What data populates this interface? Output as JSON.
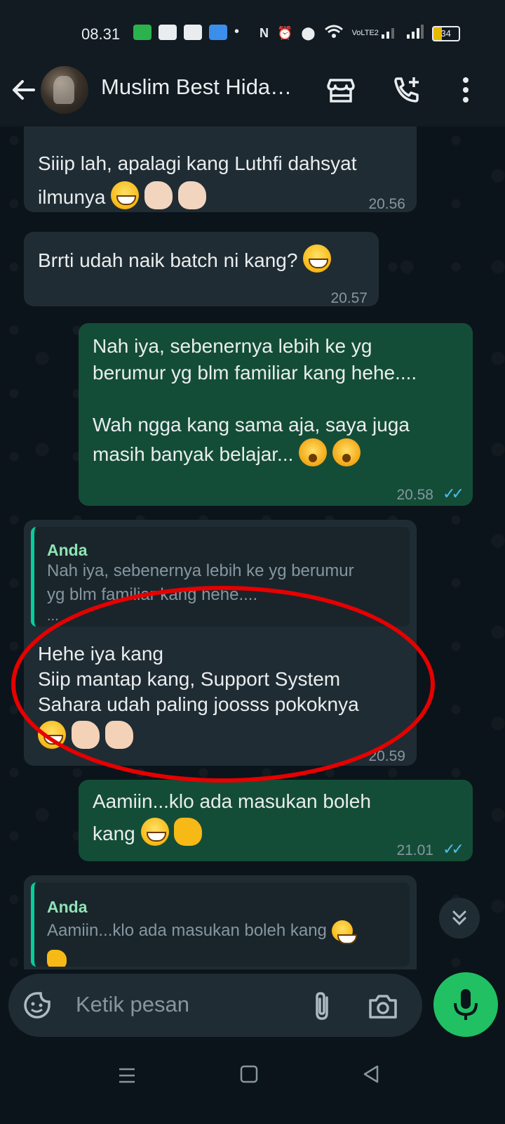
{
  "status_bar": {
    "time": "08.31",
    "battery": "34",
    "network": "VoLTE2"
  },
  "header": {
    "title": "Muslim Best Hida…",
    "back_icon": "arrow-left-icon",
    "actions": [
      "store-icon",
      "add-call-icon",
      "more-vert-icon"
    ]
  },
  "messages": [
    {
      "dir": "in",
      "text": "Siiip lah, apalagi kang Luthfi dahsyat",
      "text2": "ilmunya",
      "time": "20.56"
    },
    {
      "dir": "in",
      "text": "Brrti udah naik batch ni kang?",
      "time": "20.57"
    },
    {
      "dir": "out",
      "lines": [
        "Nah iya, sebenernya lebih ke yg",
        "berumur yg blm familiar kang hehe....",
        "Wah ngga kang sama aja, saya juga",
        "masih banyak belajar..."
      ],
      "time": "20.58"
    },
    {
      "dir": "in",
      "quote_author": "Anda",
      "quote_lines": [
        "Nah iya, sebenernya lebih ke yg berumur",
        "yg blm familiar kang hehe....",
        "..."
      ],
      "lines": [
        "Hehe iya kang",
        "Siip mantap kang, Support System",
        "Sahara udah paling joosss pokoknya"
      ],
      "time": "20.59"
    },
    {
      "dir": "out",
      "lines": [
        "Aamiin...klo ada masukan boleh",
        "kang"
      ],
      "time": "21.01"
    },
    {
      "dir": "in",
      "quote_author": "Anda",
      "quote_lines": [
        "Aamiin...klo ada masukan boleh kang"
      ]
    }
  ],
  "input": {
    "placeholder": "Ketik pesan"
  },
  "colors": {
    "background": "#0b141a",
    "incoming_bubble": "#202c33",
    "outgoing_bubble": "#144d37",
    "accent": "#21c063",
    "annotation": "#e60000"
  }
}
